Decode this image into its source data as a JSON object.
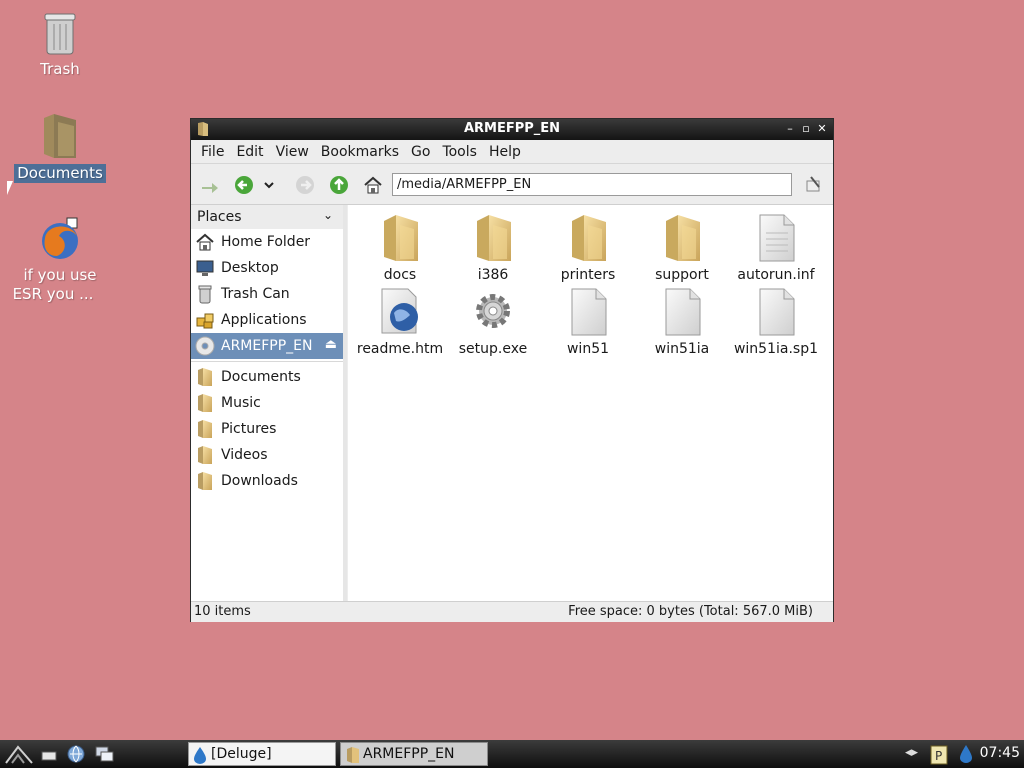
{
  "desktop": {
    "icons": [
      {
        "label": "Trash"
      },
      {
        "label": "Documents"
      },
      {
        "label_line1": "if you use",
        "label_line2": "ESR you ..."
      }
    ]
  },
  "window": {
    "title": "ARMEFPP_EN",
    "menu": [
      "File",
      "Edit",
      "View",
      "Bookmarks",
      "Go",
      "Tools",
      "Help"
    ],
    "path": "/media/ARMEFPP_EN",
    "sidebar": {
      "header": "Places",
      "items": [
        {
          "label": "Home Folder",
          "icon": "home-icon"
        },
        {
          "label": "Desktop",
          "icon": "desktop-icon"
        },
        {
          "label": "Trash Can",
          "icon": "trash-icon"
        },
        {
          "label": "Applications",
          "icon": "applications-icon"
        },
        {
          "label": "ARMEFPP_EN",
          "icon": "cdrom-icon",
          "active": true
        }
      ],
      "bookmarks": [
        {
          "label": "Documents",
          "icon": "folder-icon"
        },
        {
          "label": "Music",
          "icon": "folder-icon"
        },
        {
          "label": "Pictures",
          "icon": "folder-icon"
        },
        {
          "label": "Videos",
          "icon": "folder-icon"
        },
        {
          "label": "Downloads",
          "icon": "folder-icon"
        }
      ]
    },
    "files": [
      {
        "name": "docs",
        "type": "folder"
      },
      {
        "name": "i386",
        "type": "folder"
      },
      {
        "name": "printers",
        "type": "folder"
      },
      {
        "name": "support",
        "type": "folder"
      },
      {
        "name": "autorun.inf",
        "type": "file"
      },
      {
        "name": "readme.htm",
        "type": "html"
      },
      {
        "name": "setup.exe",
        "type": "exe"
      },
      {
        "name": "win51",
        "type": "file"
      },
      {
        "name": "win51ia",
        "type": "file"
      },
      {
        "name": "win51ia.sp1",
        "type": "file"
      }
    ],
    "status": {
      "items": "10 items",
      "free": "Free space: 0 bytes (Total: 567.0 MiB)"
    }
  },
  "taskbar": {
    "tasks": [
      "[Deluge]",
      "ARMEFPP_EN"
    ],
    "clock": "07:45"
  },
  "colors": {
    "desktop_bg": "#d58489",
    "selection": "#6d8fb8",
    "folder": "#e9c77e"
  }
}
